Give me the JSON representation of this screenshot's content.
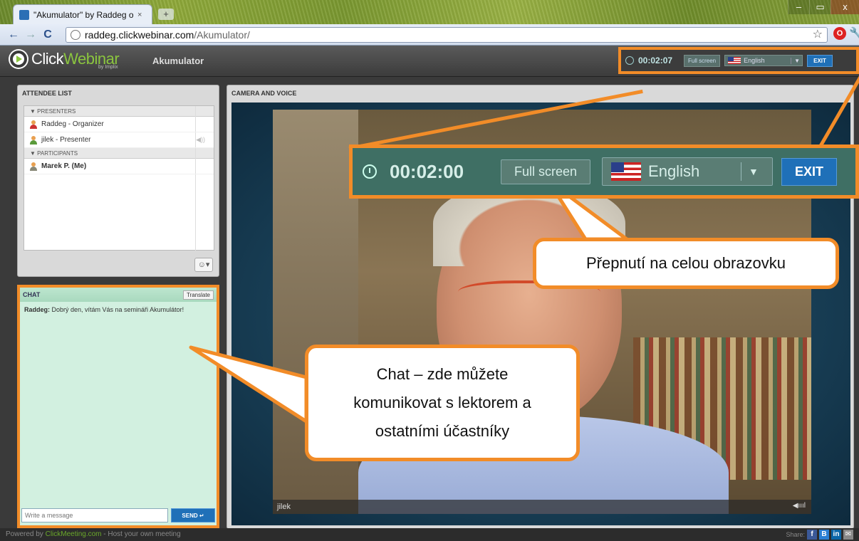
{
  "browser": {
    "tab_title": "\"Akumulator\" by Raddeg o",
    "tab_close": "×",
    "new_tab": "+",
    "url_host": "raddeg.clickwebinar.com",
    "url_path": "/Akumulator/",
    "back": "←",
    "forward": "→",
    "reload": "C",
    "star": "☆",
    "opera": "O",
    "wrench": "🔧",
    "win_min": "–",
    "win_max": "▭",
    "win_close": "x"
  },
  "app": {
    "logo_click": "Click",
    "logo_webinar": "Webinar",
    "logo_by": "by Implix",
    "meeting_name": "Akumulator",
    "timer": "00:02:07",
    "fullscreen": "Full screen",
    "language": "English",
    "exit": "EXIT"
  },
  "attendees": {
    "title": "ATTENDEE LIST",
    "presenters_group": "▼ PRESENTERS",
    "participants_group": "▼ PARTICIPANTS",
    "presenters": [
      {
        "name": "Raddeg - Organizer"
      },
      {
        "name": "jilek - Presenter"
      }
    ],
    "participants": [
      {
        "name": "Marek P. (Me)"
      }
    ],
    "emote": "☺▾"
  },
  "chat": {
    "title": "CHAT",
    "translate": "Translate",
    "messages": [
      {
        "author": "Raddeg:",
        "text": " Dobrý den, vítám Vás na semináři Akumulátor!"
      }
    ],
    "input_placeholder": "Write a message",
    "send": "SEND ↵"
  },
  "camera": {
    "title": "CAMERA AND VOICE",
    "presenter_name": "jilek",
    "volume": "◀ıııl"
  },
  "footer": {
    "powered_prefix": "Powered by ",
    "powered_link": "ClickMeeting.com",
    "powered_suffix": " - Host your own meeting",
    "share": "Share:",
    "facebook": "f",
    "buzz": "B",
    "linkedin": "in",
    "email": "✉"
  },
  "zoom": {
    "timer": "00:02:00",
    "fullscreen": "Full screen",
    "language": "English",
    "exit": "EXIT"
  },
  "callouts": {
    "fullscreen": "Přepnutí na celou obrazovku",
    "chat_line1": "Chat – zde můžete",
    "chat_line2": "komunikovat s lektorem a",
    "chat_line3": "ostatními účastníky"
  },
  "colors": {
    "highlight": "#f28c28",
    "button_blue": "#1f70b8",
    "brand_green": "#8bc53f"
  }
}
